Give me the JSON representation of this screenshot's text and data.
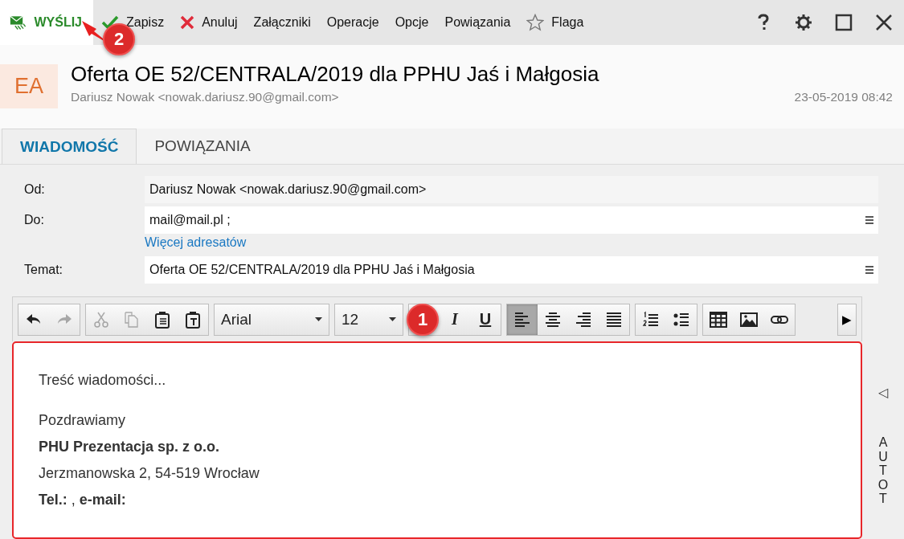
{
  "toolbar": {
    "send": {
      "label": "WYŚLIJ",
      "callout": "2"
    },
    "items": [
      {
        "kind": "save",
        "label": "Zapisz"
      },
      {
        "kind": "cancel",
        "label": "Anuluj"
      },
      {
        "kind": "plain",
        "label": "Załączniki"
      },
      {
        "kind": "plain",
        "label": "Operacje"
      },
      {
        "kind": "plain",
        "label": "Opcje"
      },
      {
        "kind": "plain",
        "label": "Powiązania"
      },
      {
        "kind": "flag",
        "label": "Flaga"
      }
    ],
    "window_buttons": [
      {
        "kind": "help"
      },
      {
        "kind": "settings"
      },
      {
        "kind": "maximize"
      },
      {
        "kind": "close"
      }
    ]
  },
  "header": {
    "avatar": "EA",
    "title": "Oferta OE 52/CENTRALA/2019 dla PPHU Jaś i Małgosia",
    "sender": "Dariusz Nowak <nowak.dariusz.90@gmail.com>",
    "date": "23-05-2019 08:42"
  },
  "tabs": [
    {
      "label": "WIADOMOŚĆ",
      "selected": true
    },
    {
      "label": "POWIĄZANIA",
      "selected": false
    }
  ],
  "form": [
    {
      "kind": "readonly",
      "label": "Od:",
      "value": "Dariusz Nowak <nowak.dariusz.90@gmail.com>"
    },
    {
      "kind": "field",
      "label": "Do:",
      "value": "mail@mail.pl ;",
      "link": "Więcej adresatów"
    },
    {
      "kind": "field",
      "label": "Temat:",
      "value": "Oferta OE 52/CENTRALA/2019 dla PPHU Jaś i Małgosia"
    }
  ],
  "editor_toolbar": [
    {
      "kind": "group",
      "buttons": [
        {
          "kind": "undo",
          "disabled": false
        },
        {
          "kind": "redo",
          "disabled": true
        }
      ]
    },
    {
      "kind": "group",
      "buttons": [
        {
          "kind": "cut",
          "disabled": true
        },
        {
          "kind": "copy",
          "disabled": true
        },
        {
          "kind": "paste",
          "disabled": false
        },
        {
          "kind": "paste-text",
          "disabled": false
        }
      ]
    },
    {
      "kind": "dropdown",
      "value": "Arial"
    },
    {
      "kind": "dropdown",
      "value": "12"
    },
    {
      "kind": "group",
      "buttons": [
        {
          "kind": "bold",
          "callout": "1"
        },
        {
          "kind": "italic",
          "label": "I"
        },
        {
          "kind": "underline",
          "label": "U"
        }
      ]
    },
    {
      "kind": "group",
      "buttons": [
        {
          "kind": "align-left",
          "selected": true
        },
        {
          "kind": "align-center",
          "selected": false
        },
        {
          "kind": "align-right",
          "selected": false
        },
        {
          "kind": "align-justify",
          "selected": false
        }
      ]
    },
    {
      "kind": "group",
      "buttons": [
        {
          "kind": "ordered-list"
        },
        {
          "kind": "bullet-list"
        }
      ]
    },
    {
      "kind": "group",
      "buttons": [
        {
          "kind": "table"
        },
        {
          "kind": "image"
        },
        {
          "kind": "link"
        }
      ]
    },
    {
      "kind": "more",
      "label": "▶"
    }
  ],
  "body": [
    {
      "kind": "text",
      "text": "Treść wiadomości..."
    },
    {
      "kind": "gap"
    },
    {
      "kind": "text",
      "text": "Pozdrawiamy"
    },
    {
      "kind": "bold",
      "text": "PHU Prezentacja sp. z o.o."
    },
    {
      "kind": "text",
      "text": "Jerzmanowska 2, 54-519 Wrocław"
    },
    {
      "kind": "text",
      "text": "**Tel.:** , **e-mail:**"
    }
  ],
  "side_panel": {
    "toggle": "◁",
    "label": "AUTOT"
  }
}
